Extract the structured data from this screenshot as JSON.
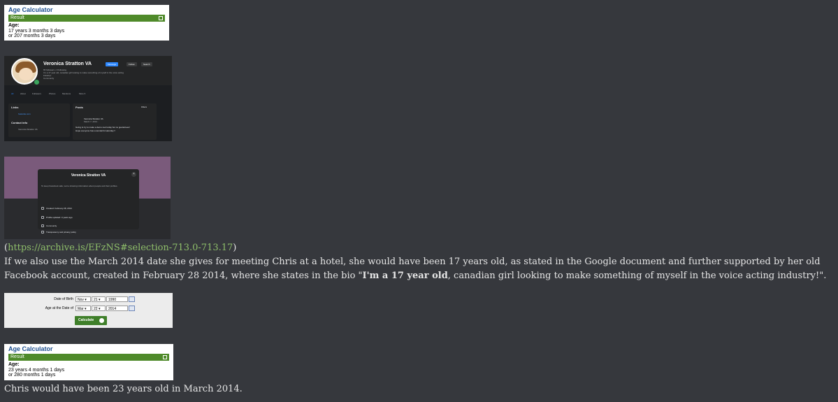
{
  "calc1": {
    "title": "Age Calculator",
    "bar": "Result",
    "label": "Age:",
    "line1": "17 years 3 months 3 days",
    "line2": "or 207 months 3 days"
  },
  "profile": {
    "name": "Veronica Stratton VA",
    "meta1": "65 followers • 0 following",
    "meta2": "I'm a 17 year old, canadian girl looking to make something of myself in the voice acting industry!",
    "meta3": "Community",
    "btn_message": "Message",
    "btn_follow": "Follow",
    "btn_search": "Search",
    "tabs": [
      "All",
      "About",
      "Followers",
      "Photos",
      "Mentions",
      "More ▾"
    ],
    "links_title": "Links",
    "links_item": "fusionite.com",
    "contact_title": "Contact info",
    "contact_item": "Veronica Stratton VA",
    "posts_title": "Posts",
    "filters": "Filters",
    "post_author": "Veronica Stratton VA",
    "post_date": "March 7, 2014 ·",
    "post_line1": "Going to try to make a demo reel today but no guarantees!",
    "post_line2": "Hope everyone has a wonderful saturday !!"
  },
  "modal": {
    "title": "Veronica Stratton VA",
    "close": "×",
    "desc": "To keep Facebook safe, we're showing information about people and their profiles.",
    "rows": [
      "Created: February 28, 2014",
      "Profile updated: 3 years ago",
      "Community",
      "Transparency and privacy policy"
    ]
  },
  "source": {
    "open": "(",
    "url": "https://archive.is/EFzNS#selection-713.0-713.17",
    "close": ")"
  },
  "paragraph": {
    "part1": "If we also use the March 2014 date she gives for meeting Chris at a hotel, she would have been 17 years old, as stated in the Google document and further supported by her old Facebook account, created in February 28 2014, where she states in the bio \"",
    "bold": "I'm a 17 year old",
    "part2": ", canadian girl looking to make something of myself in the voice acting industry!\"."
  },
  "dateform": {
    "dob_label": "Date of Birth",
    "dob_month": "Nov",
    "dob_day": "21",
    "dob_year": "1990",
    "at_label": "Age at the Date of",
    "at_month": "Mar",
    "at_day": "22",
    "at_year": "2014",
    "calculate": "Calculate"
  },
  "calc2": {
    "title": "Age Calculator",
    "bar": "Result",
    "label": "Age:",
    "line1": "23 years 4 months 1 days",
    "line2": "or 280 months 1 days"
  },
  "conclusion": "Chris would have been 23 years old in March 2014."
}
